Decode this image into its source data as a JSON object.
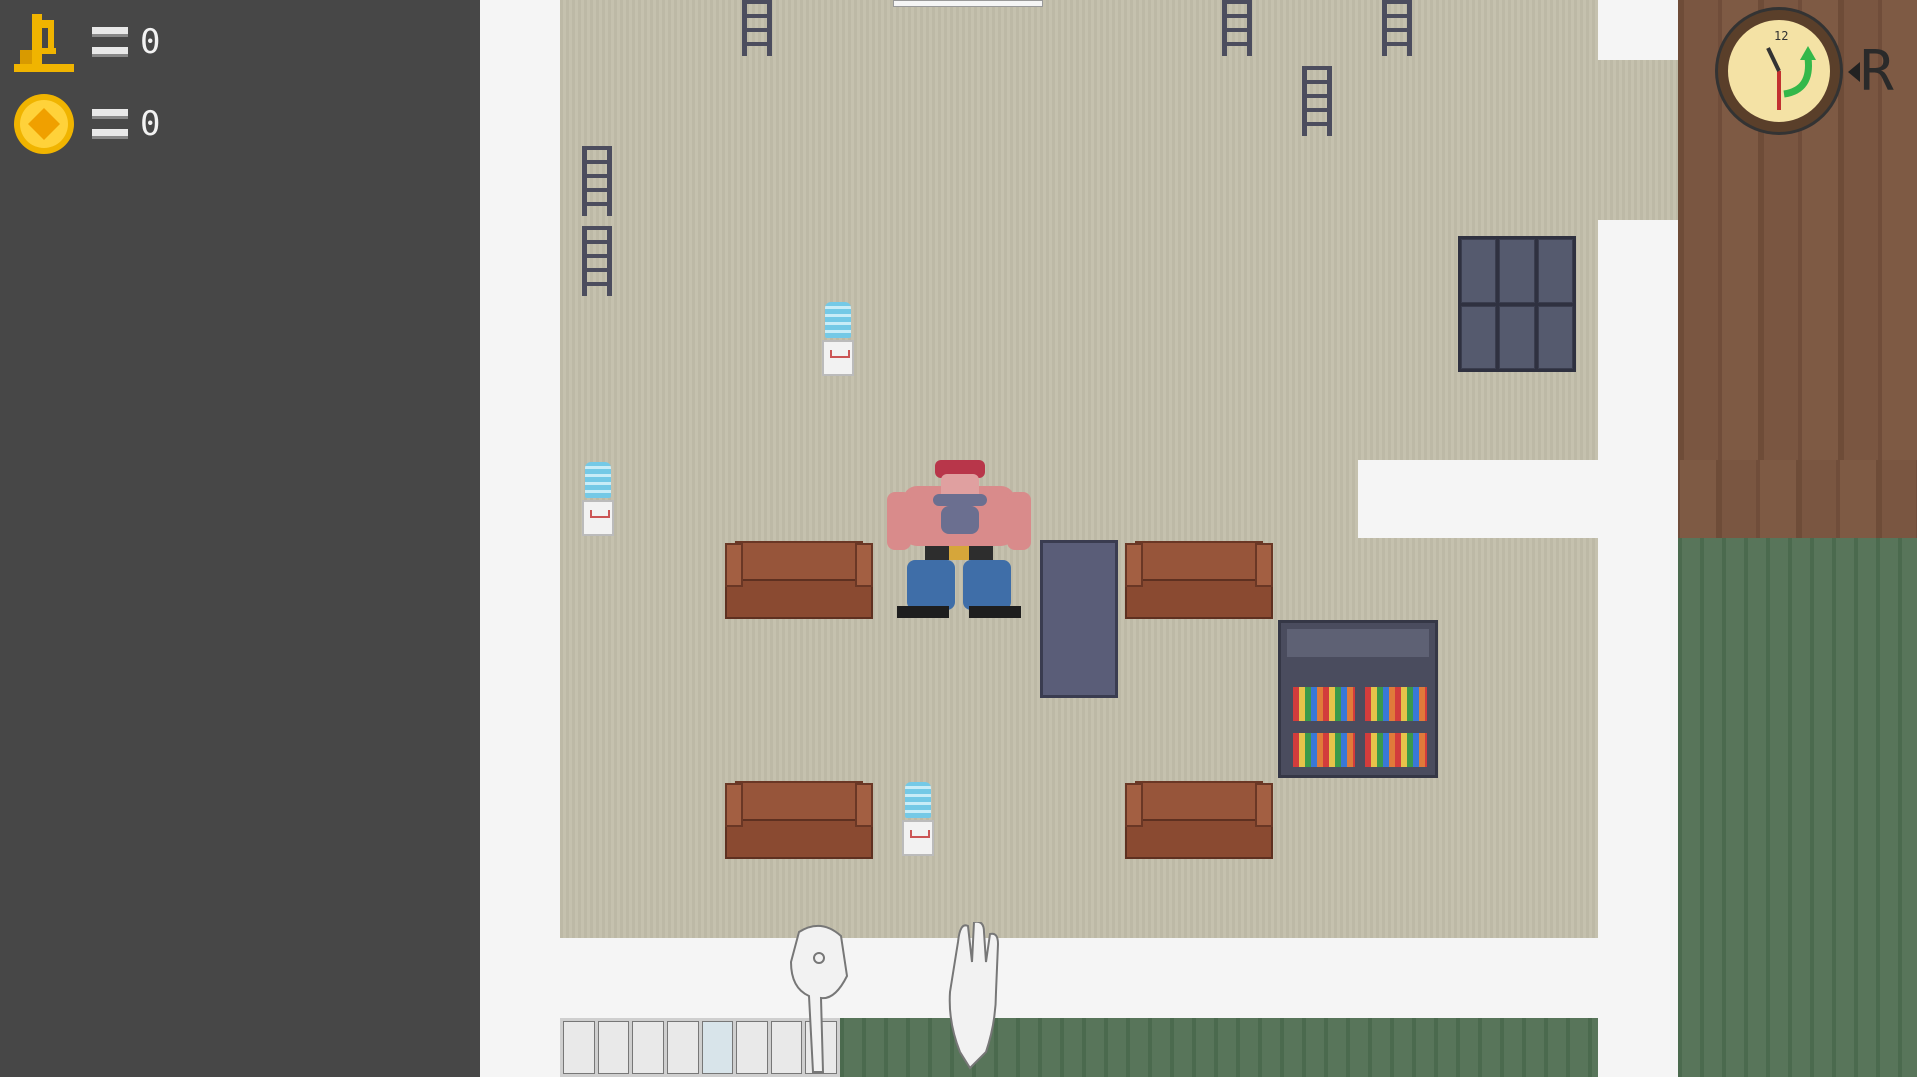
{
  "hud": {
    "tools": {
      "icon": "tool-icon",
      "count": "0"
    },
    "coins": {
      "icon": "coin-icon",
      "count": "0"
    }
  },
  "clock": {
    "icon": "clock-icon",
    "key_hint": "R"
  },
  "colors": {
    "hud_bg": "#474747",
    "floor": "#c3bfab",
    "wall": "#f5f5f5",
    "wood": "#7a5641",
    "grass": "#58755a",
    "couch": "#8a4a31",
    "metal": "#4c4d5e",
    "hud_icon": "#f0b400"
  }
}
